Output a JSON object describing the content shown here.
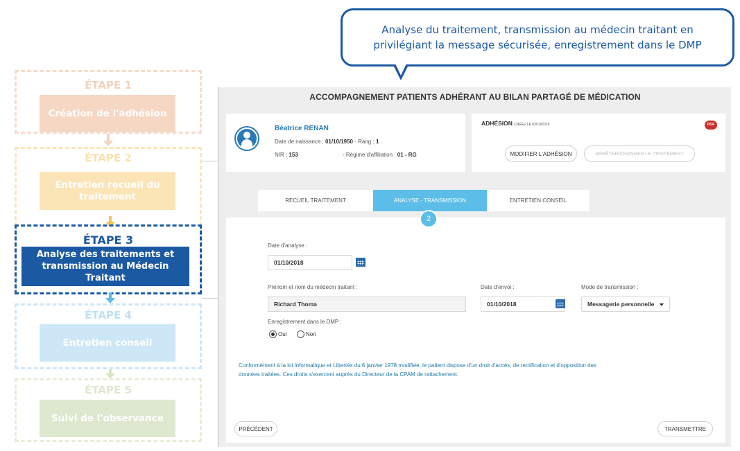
{
  "steps": [
    {
      "title": "ÉTAPE 1",
      "label": "Création de l'adhésion"
    },
    {
      "title": "ÉTAPE 2",
      "label": "Entretien recueil du traitement"
    },
    {
      "title": "ÉTAPE 3",
      "label": "Analyse des traitements et transmission au Médecin Traitant"
    },
    {
      "title": "ÉTAPE 4",
      "label": "Entretien conseil"
    },
    {
      "title": "ÉTAPE 5",
      "label": "Suivi de l'observance"
    }
  ],
  "callout": {
    "line1": "Analyse du traitement, transmission au médecin traitant en",
    "line2": "privilégiant la message sécurisée, enregistrement dans le DMP"
  },
  "app": {
    "title": "ACCOMPAGNEMENT PATIENTS ADHÉRANT AU BILAN PARTAGÉ DE MÉDICATION",
    "patient": {
      "name": "Béatrice RENAN",
      "dob_label": "Date de naissance :",
      "dob": "01/10/1950",
      "rang_label": "- Rang :",
      "rang": "1",
      "nir_label": "NIR :",
      "nir": "153",
      "regime_label": "- Régime d'affiliation :",
      "regime": "01 - RG"
    },
    "adhesion": {
      "title": "ADHÉSION",
      "created": "CRÉÉE LE 03/10/2018",
      "pdf": "PDF",
      "modify_label": "MODIFIER L'ADHÉSION",
      "stop_label": "ARRÊTER/CHANGER LE TRAITEMENT"
    },
    "tabs": [
      {
        "label": "RECUEIL TRAITEMENT"
      },
      {
        "label": "ANALYSE - TRANSMISSION"
      },
      {
        "label": "ENTRETIEN CONSEIL"
      }
    ],
    "active_step_number": "2",
    "form": {
      "analysis_date_label": "Date d'analyse :",
      "analysis_date": "01/10/2018",
      "doctor_label": "Prénom et nom du médecin traitant :",
      "doctor": "Richard Thoma",
      "send_date_label": "Date d'envoi :",
      "send_date": "01/10/2018",
      "mode_label": "Mode de transmission :",
      "mode": "Messagerie personnelle",
      "dmp_label": "Enregistrement dans le DMP :",
      "dmp_yes": "Oui",
      "dmp_no": "Non",
      "dmp_selected": "Oui"
    },
    "legal_line1": "Conformément à la loi Informatique et Libertés du 6 janvier 1978 modifiée, le patient dispose d'un droit d'accès, de rectification et d'opposition des",
    "legal_line2": "données traitées. Ces droits s'exercent auprès du Directeur de la CPAM de rattachement.",
    "prev_label": "PRÉCÉDENT",
    "next_label": "TRANSMETTRE"
  },
  "colors": {
    "step3": "#1b5aa3",
    "tab_active": "#5bbde8",
    "patient_name": "#2a7ab8"
  },
  "icons": [
    "arrow-down-icon",
    "avatar-icon",
    "pdf-icon",
    "calendar-icon",
    "caret-down-icon"
  ]
}
